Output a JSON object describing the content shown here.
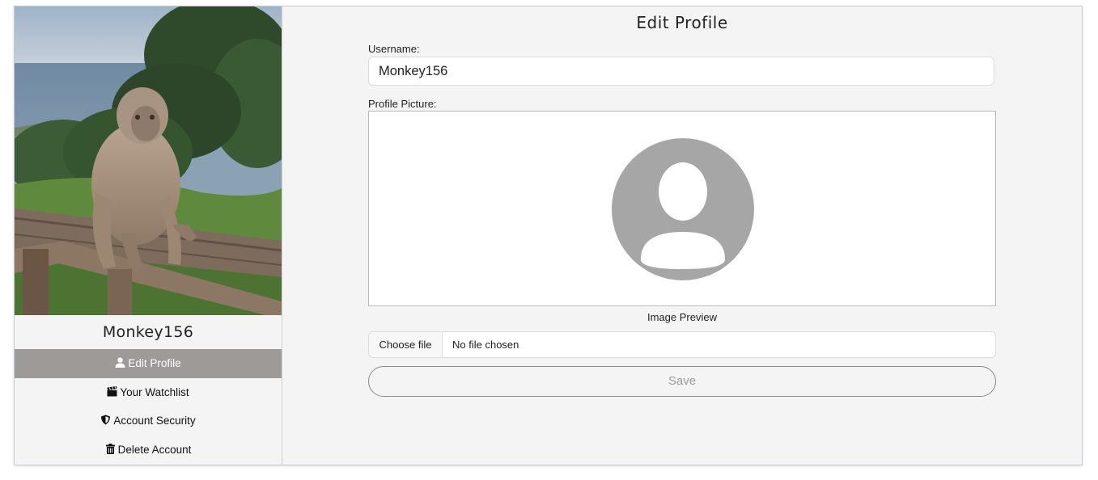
{
  "profile": {
    "username": "Monkey156"
  },
  "sidebar": {
    "items": [
      {
        "label": "Edit Profile",
        "icon": "user-icon",
        "active": true
      },
      {
        "label": "Your Watchlist",
        "icon": "clapperboard-icon",
        "active": false
      },
      {
        "label": "Account Security",
        "icon": "shield-icon",
        "active": false
      },
      {
        "label": "Delete Account",
        "icon": "trash-icon",
        "active": false
      }
    ]
  },
  "form": {
    "title": "Edit Profile",
    "username_label": "Username:",
    "username_value": "Monkey156",
    "picture_label": "Profile Picture:",
    "preview_caption": "Image Preview",
    "choose_file_label": "Choose file",
    "file_status": "No file chosen",
    "save_label": "Save"
  },
  "colors": {
    "active_nav_bg": "#9e9a97",
    "page_bg": "#f4f4f4",
    "avatar_placeholder": "#a6a6a6"
  }
}
